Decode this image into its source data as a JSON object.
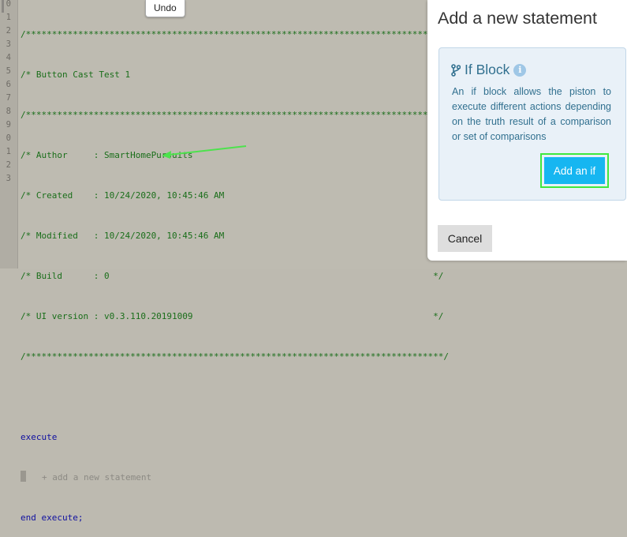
{
  "editor": {
    "line_numbers": [
      "0",
      "1",
      "2",
      "3",
      "4",
      "5",
      "6",
      "7",
      "8",
      "9",
      "0",
      "1",
      "2",
      "3"
    ],
    "lines": [
      "/********************************************************************************/",
      "/* Button Cast Test 1                                                          */",
      "/********************************************************************************/",
      "/* Author     : SmartHomePursuits                                              */",
      "/* Created    : 10/24/2020, 10:45:46 AM                                        */",
      "/* Modified   : 10/24/2020, 10:45:46 AM                                        */",
      "/* Build      : 0                                                              */",
      "/* UI version : v0.3.110.20191009                                              */",
      "/********************************************************************************/",
      "",
      "execute",
      "+ add a new statement",
      "end execute;"
    ],
    "tooltip": "Undo",
    "arrow_color": "#4de24d"
  },
  "modal": {
    "title": "Add a new statement",
    "panel_title": "If Block",
    "panel_icon": "code-branch-icon",
    "info_icon_glyph": "i",
    "description": "An if block allows the piston to execute different actions depending on the truth result of a comparison or set of comparisons",
    "add_button": "Add an if",
    "cancel_button": "Cancel",
    "accent_color": "#16b6f1",
    "highlight_color": "#3ee83e"
  }
}
